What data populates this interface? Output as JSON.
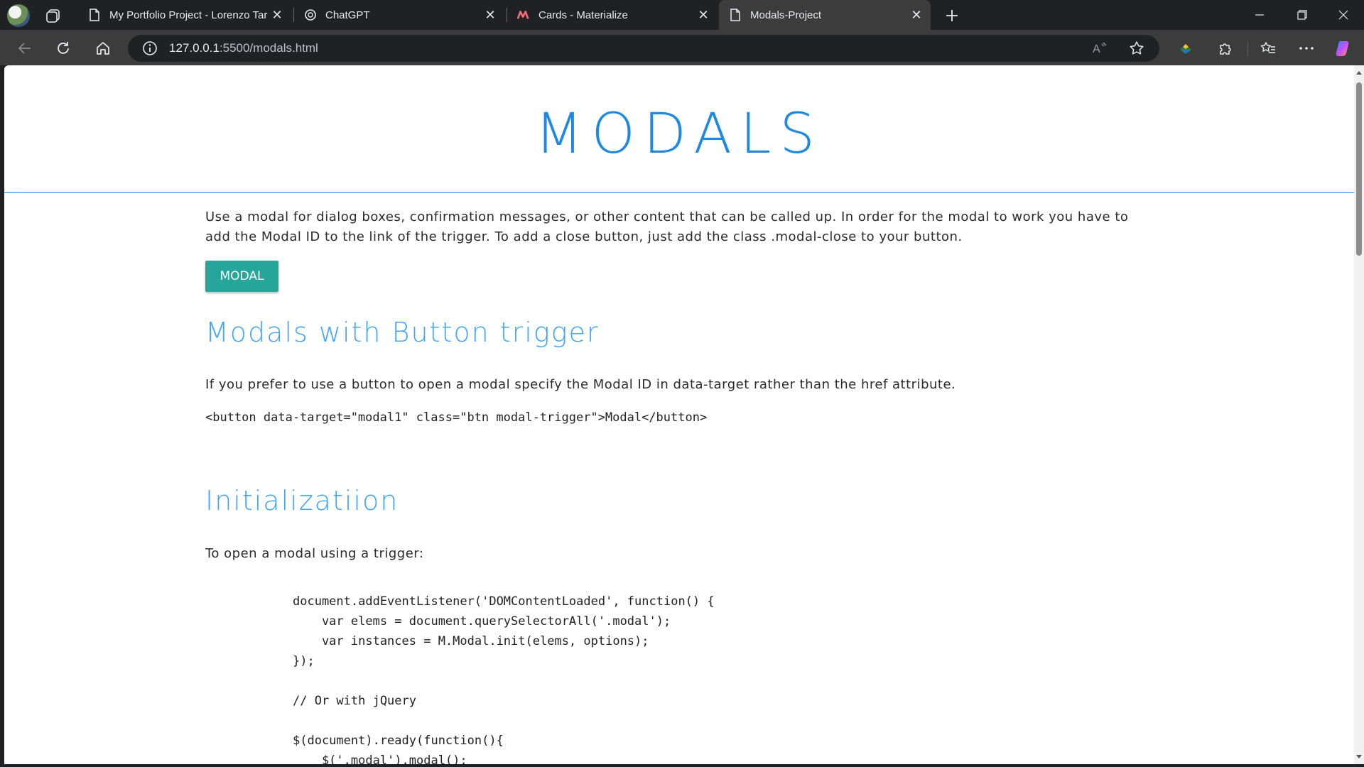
{
  "browser": {
    "tabs": [
      {
        "title": "My Portfolio Project - Lorenzo Tar",
        "icon": "page-icon",
        "active": false
      },
      {
        "title": "ChatGPT",
        "icon": "chatgpt-icon",
        "active": false
      },
      {
        "title": "Cards - Materialize",
        "icon": "materialize-icon",
        "active": false
      },
      {
        "title": "Modals-Project",
        "icon": "page-icon",
        "active": true
      }
    ],
    "url_host": "127.0.0.1",
    "url_path": ":5500/modals.html"
  },
  "page": {
    "title": "MODALS",
    "intro": "Use a modal for dialog boxes, confirmation messages, or other content that can be called up. In order for the modal to work you have to add the Modal ID to the link of the trigger. To add a close button, just add the class .modal-close to your button.",
    "modal_button": "MODAL",
    "section1": {
      "heading": "Modals with Button trigger",
      "text": "If you prefer to use a button to open a modal specify the Modal ID in data-target rather than the href attribute.",
      "code": "<button data-target=\"modal1\" class=\"btn modal-trigger\">Modal</button>"
    },
    "section2": {
      "heading": "Initializatiion",
      "text": "To open a modal using a trigger:",
      "code": "document.addEventListener('DOMContentLoaded', function() {\n    var elems = document.querySelectorAll('.modal');\n    var instances = M.Modal.init(elems, options);\n});\n\n// Or with jQuery\n\n$(document).ready(function(){\n    $('.modal').modal();"
    }
  },
  "colors": {
    "accent": "#1e88e5",
    "heading": "#42a5f5",
    "button": "#26a69a"
  }
}
